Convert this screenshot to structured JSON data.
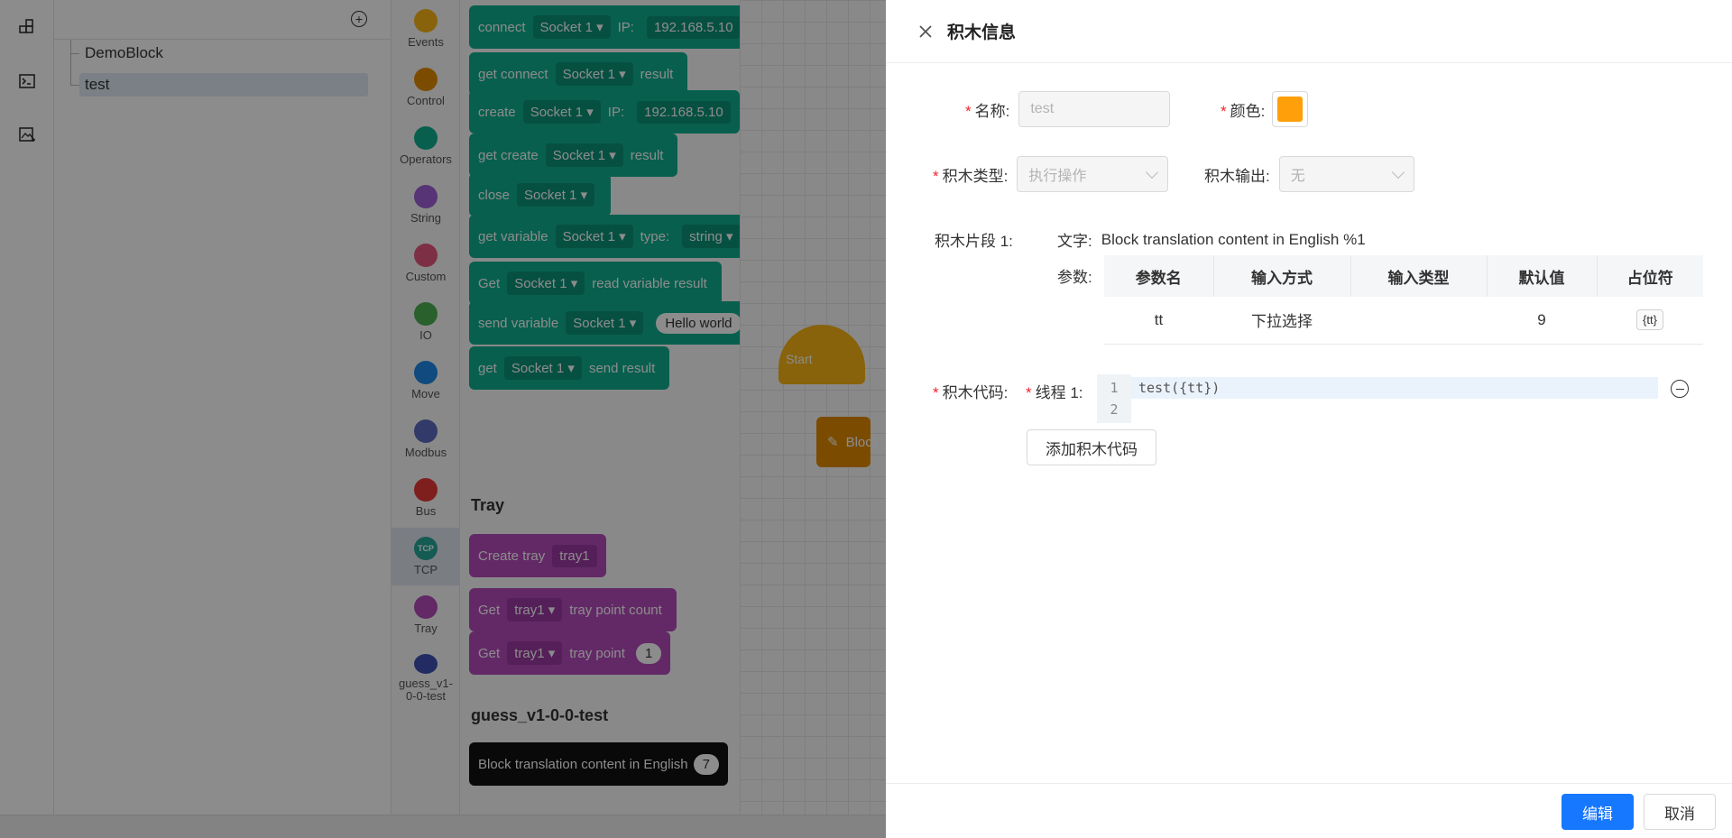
{
  "tree": {
    "items": [
      {
        "label": "DemoBlock"
      },
      {
        "label": "test"
      }
    ]
  },
  "categories": [
    {
      "label": "Events",
      "color": "#f7b515"
    },
    {
      "label": "Control",
      "color": "#e08a00"
    },
    {
      "label": "Operators",
      "color": "#0fae8f"
    },
    {
      "label": "String",
      "color": "#9f5fd6"
    },
    {
      "label": "Custom",
      "color": "#e4577f"
    },
    {
      "label": "IO",
      "color": "#4caf50"
    },
    {
      "label": "Move",
      "color": "#1e88e5"
    },
    {
      "label": "Modbus",
      "color": "#5c6bc0"
    },
    {
      "label": "Bus",
      "color": "#e53935"
    },
    {
      "label": "TCP",
      "color": "#26a69a",
      "icon_text": "TCP"
    },
    {
      "label": "Tray",
      "color": "#b44bbc"
    },
    {
      "label": "guess_v1-0-0-test",
      "color": "#3f51b5"
    }
  ],
  "palette": {
    "blocks": [
      {
        "parts": [
          "connect",
          "Socket 1 ▾",
          "IP:",
          "192.168.5.10"
        ]
      },
      {
        "parts": [
          "get connect",
          "Socket 1 ▾",
          "result"
        ]
      },
      {
        "parts": [
          "create",
          "Socket 1 ▾",
          "IP:",
          "192.168.5.10"
        ]
      },
      {
        "parts": [
          "get create",
          "Socket 1 ▾",
          "result"
        ]
      },
      {
        "parts": [
          "close",
          "Socket 1 ▾"
        ]
      },
      {
        "parts": [
          "get variable",
          "Socket 1 ▾",
          "type:",
          "string ▾"
        ]
      },
      {
        "parts": [
          "Get",
          "Socket 1 ▾",
          "read variable result"
        ]
      },
      {
        "parts": [
          "send variable",
          "Socket 1 ▾",
          "Hello world"
        ]
      },
      {
        "parts": [
          "get",
          "Socket 1 ▾",
          "send result"
        ]
      }
    ],
    "tray_section": "Tray",
    "tray_blocks": [
      {
        "parts": [
          "Create tray",
          "tray1"
        ]
      },
      {
        "parts": [
          "Get",
          "tray1 ▾",
          "tray point count"
        ]
      },
      {
        "parts": [
          "Get",
          "tray1 ▾",
          "tray point",
          "1"
        ]
      }
    ],
    "guess_section": "guess_v1-0-0-test",
    "guess_block": {
      "text": "Block translation content in English",
      "value": "7"
    }
  },
  "canvas": {
    "start_label": "Start",
    "block_label": "Block"
  },
  "drawer": {
    "title": "积木信息",
    "name_label": "名称:",
    "name_value": "test",
    "color_label": "颜色:",
    "color_value": "#ff9f0a",
    "type_label": "积木类型:",
    "type_value": "执行操作",
    "output_label": "积木输出:",
    "output_value": "无",
    "segment_label": "积木片段 1:",
    "text_label": "文字:",
    "text_value": "Block translation content in English %1",
    "params_label": "参数:",
    "params_headers": [
      "参数名",
      "输入方式",
      "输入类型",
      "默认值",
      "占位符"
    ],
    "params_rows": [
      {
        "name": "tt",
        "method": "下拉选择",
        "type": "",
        "default": "9",
        "placeholder": "{tt}"
      }
    ],
    "code_label": "积木代码:",
    "thread_label": "线程 1:",
    "code_lines": [
      {
        "no": "1",
        "text": "test({tt})"
      },
      {
        "no": "2",
        "text": ""
      }
    ],
    "add_code_label": "添加积木代码",
    "edit_label": "编辑",
    "cancel_label": "取消"
  }
}
